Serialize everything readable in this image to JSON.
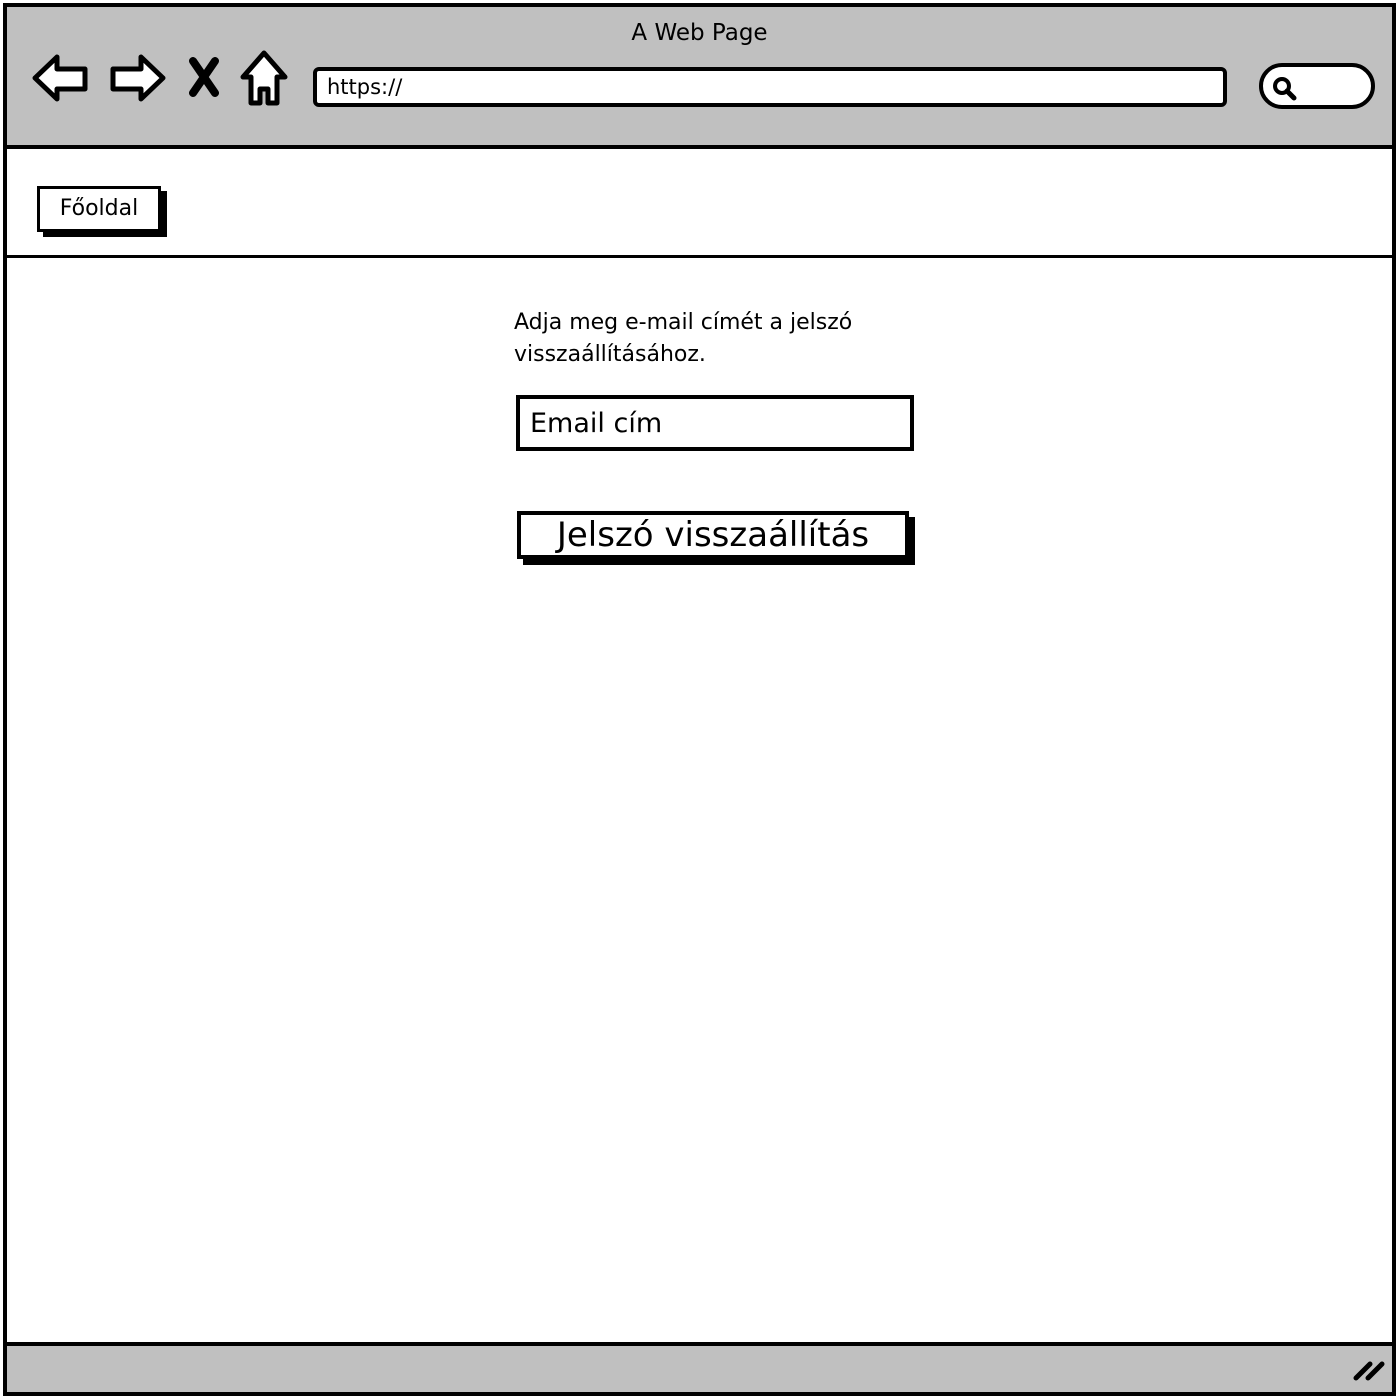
{
  "window": {
    "title": "A Web Page"
  },
  "browser": {
    "url": "https://",
    "search_placeholder": ""
  },
  "nav": {
    "home_label": "Főoldal"
  },
  "form": {
    "instruction": "Adja meg e-mail címét a jelszó visszaállításához.",
    "email_placeholder": "Email cím",
    "submit_label": "Jelszó visszaállítás"
  },
  "icons": [
    "back-arrow-icon",
    "forward-arrow-icon",
    "close-icon",
    "home-icon",
    "search-icon",
    "resize-handle-icon"
  ],
  "colors": {
    "chrome": "#c0c0c0",
    "border": "#000000",
    "background": "#ffffff"
  }
}
